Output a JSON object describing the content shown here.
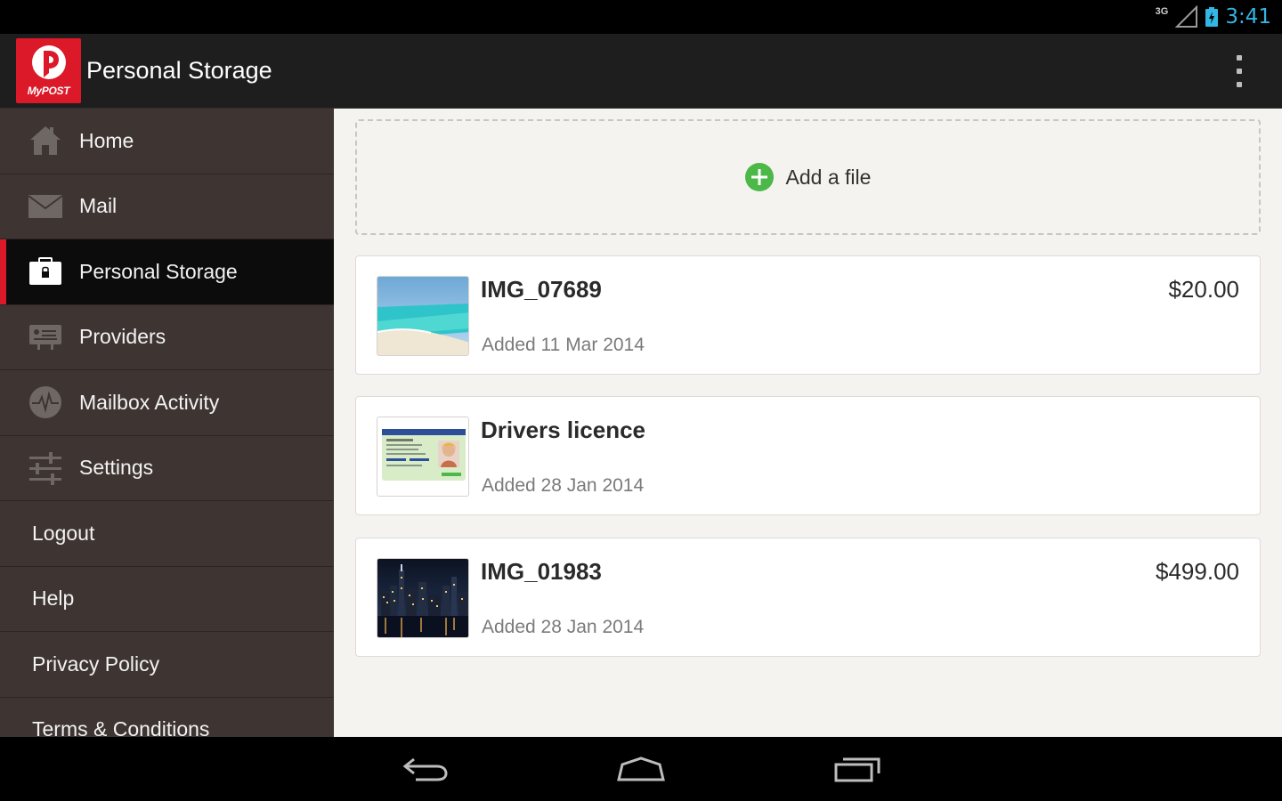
{
  "status": {
    "network": "3G",
    "time": "3:41"
  },
  "appbar": {
    "logo_text": "MyPOST",
    "title": "Personal Storage"
  },
  "sidebar": {
    "items": [
      {
        "label": "Home",
        "icon": "home-icon"
      },
      {
        "label": "Mail",
        "icon": "mail-icon"
      },
      {
        "label": "Personal Storage",
        "icon": "storage-icon",
        "active": true
      },
      {
        "label": "Providers",
        "icon": "providers-icon"
      },
      {
        "label": "Mailbox Activity",
        "icon": "activity-icon"
      },
      {
        "label": "Settings",
        "icon": "settings-icon"
      }
    ],
    "links": [
      "Logout",
      "Help",
      "Privacy Policy",
      "Terms & Conditions"
    ]
  },
  "main": {
    "add_label": "Add a file",
    "files": [
      {
        "name": "IMG_07689",
        "date": "Added 11 Mar 2014",
        "price": "$20.00",
        "thumb": "beach-thumbnail"
      },
      {
        "name": "Drivers licence",
        "date": "Added 28 Jan 2014",
        "price": "",
        "thumb": "licence-thumbnail"
      },
      {
        "name": "IMG_01983",
        "date": "Added 28 Jan 2014",
        "price": "$499.00",
        "thumb": "city-night-thumbnail"
      }
    ]
  },
  "colors": {
    "brand_red": "#dc1928",
    "accent_green": "#4cb848",
    "clock_blue": "#33b5e5"
  }
}
